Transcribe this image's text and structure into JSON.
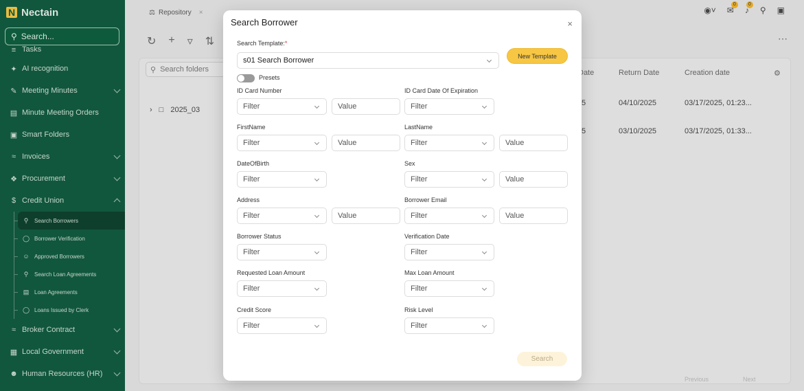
{
  "sidebar": {
    "logo_text": "Nectain",
    "search_placeholder": "Search...",
    "items": [
      {
        "label": "Tasks",
        "icon": "list-icon"
      },
      {
        "label": "AI recognition",
        "icon": "sparkle-icon"
      },
      {
        "label": "Meeting Minutes",
        "icon": "edit-icon"
      },
      {
        "label": "Minute Meeting Orders",
        "icon": "table-icon"
      },
      {
        "label": "Smart Folders",
        "icon": "folder-icon"
      },
      {
        "label": "Invoices",
        "icon": "stack-icon"
      },
      {
        "label": "Procurement",
        "icon": "cart-icon"
      },
      {
        "label": "Credit Union",
        "icon": "dollar-icon"
      }
    ],
    "credit_union_sub": [
      {
        "label": "Search Borrowers",
        "icon": "search-icon"
      },
      {
        "label": "Borrower Verification",
        "icon": "check-circle-icon"
      },
      {
        "label": "Approved Borrowers",
        "icon": "user-icon"
      },
      {
        "label": "Search Loan Agreements",
        "icon": "search-icon"
      },
      {
        "label": "Loan Agreements",
        "icon": "document-icon"
      },
      {
        "label": "Loans Issued by Clerk",
        "icon": "check-circle-icon"
      }
    ],
    "bottom_items": [
      {
        "label": "Broker Contract",
        "icon": "stack-icon"
      },
      {
        "label": "Local Government",
        "icon": "building-icon"
      },
      {
        "label": "Human Resources (HR)",
        "icon": "people-icon"
      }
    ]
  },
  "main": {
    "tabs": [
      {
        "label": "Repository"
      }
    ],
    "search_placeholder": "Search folders",
    "folder": "2025_03",
    "columns": [
      "Date",
      "Return Date",
      "Creation date"
    ],
    "rows": [
      {
        "date_tail": "5",
        "return_date": "04/10/2025",
        "creation_date": "03/17/2025, 01:23..."
      },
      {
        "date_tail": "5",
        "return_date": "03/10/2025",
        "creation_date": "03/17/2025, 01:33..."
      }
    ],
    "badges": {
      "messages": "0",
      "notifications": "0"
    },
    "pager_prev": "Previous",
    "pager_next": "Next"
  },
  "modal": {
    "title": "Search Borrower",
    "template_label": "Search Template:",
    "required_mark": "*",
    "template_value": "s01 Search Borrower",
    "new_template_label": "New Template",
    "presets_label": "Presets",
    "filter_placeholder": "Filter",
    "value_placeholder": "Value",
    "search_button": "Search",
    "fields": {
      "id_card_number": "ID Card Number",
      "id_card_expiration": "ID Card Date Of Expiration",
      "first_name": "FirstName",
      "last_name": "LastName",
      "date_of_birth": "DateOfBirth",
      "sex": "Sex",
      "address": "Address",
      "borrower_email": "Borrower Email",
      "borrower_status": "Borrower Status",
      "verification_date": "Verification Date",
      "requested_loan_amount": "Requested Loan Amount",
      "max_loan_amount": "Max Loan Amount",
      "credit_score": "Credit Score",
      "risk_level": "Risk Level"
    }
  },
  "colors": {
    "sidebar_bg": "#0e5a3d",
    "accent": "#f7c744"
  }
}
